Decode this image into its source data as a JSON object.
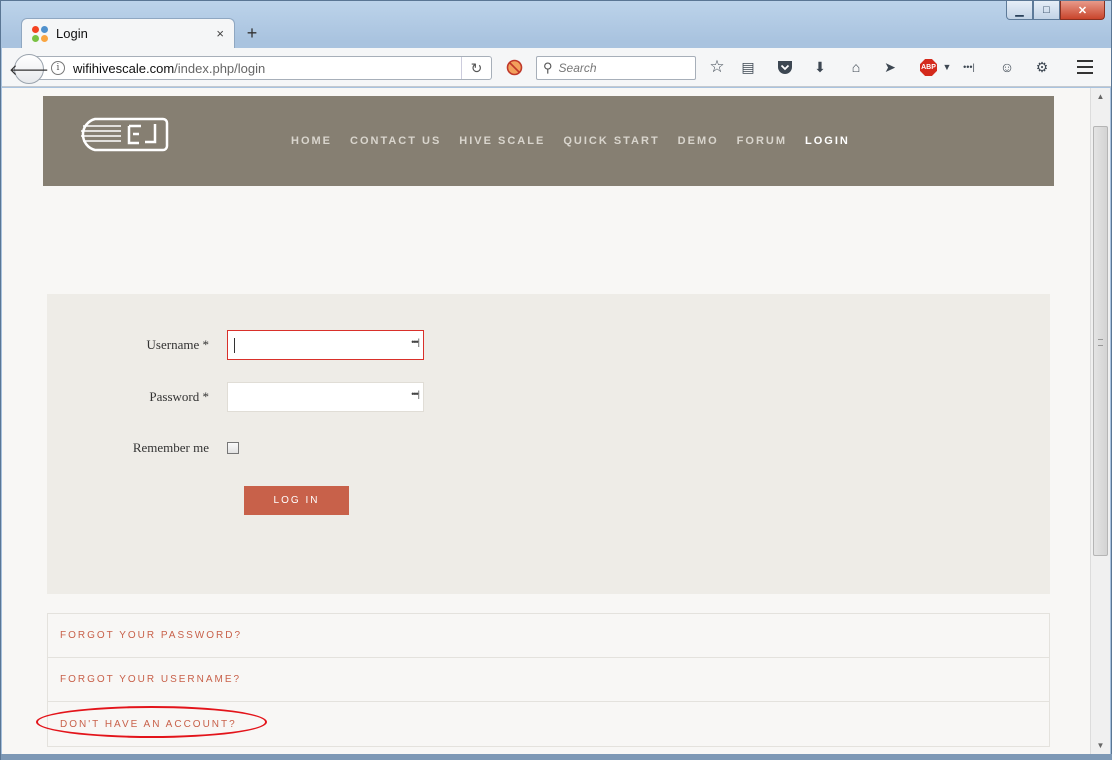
{
  "browser": {
    "tab_title": "Login",
    "tab_close": "×",
    "new_tab": "+",
    "url_domain": "wifihivescale.com",
    "url_path": "/index.php/login",
    "search_placeholder": "Search",
    "abp_label": "ABP",
    "overflow": "•••|"
  },
  "site": {
    "nav": [
      {
        "label": "HOME"
      },
      {
        "label": "CONTACT US"
      },
      {
        "label": "HIVE SCALE"
      },
      {
        "label": "QUICK START"
      },
      {
        "label": "DEMO"
      },
      {
        "label": "FORUM"
      },
      {
        "label": "LOGIN",
        "active": true
      }
    ]
  },
  "form": {
    "username_label": "Username *",
    "password_label": "Password *",
    "remember_label": "Remember me",
    "pw_icon": "•••|",
    "login_button": "LOG IN"
  },
  "links": [
    {
      "label": "FORGOT YOUR PASSWORD?"
    },
    {
      "label": "FORGOT YOUR USERNAME?"
    },
    {
      "label": "DON'T HAVE AN ACCOUNT?"
    }
  ],
  "colors": {
    "header_bg": "#867f72",
    "accent": "#c8614a",
    "highlight": "#e3141a",
    "focus_border": "#d9302a"
  }
}
